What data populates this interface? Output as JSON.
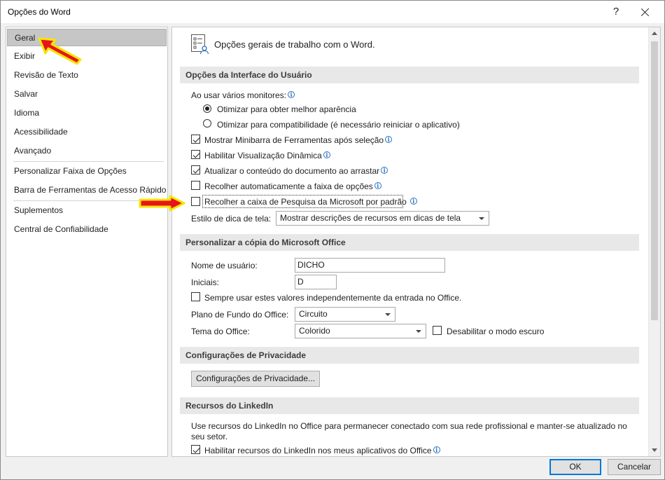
{
  "window": {
    "title": "Opções do Word",
    "help": "?",
    "close": "close"
  },
  "nav": {
    "items": [
      {
        "label": "Geral"
      },
      {
        "label": "Exibir"
      },
      {
        "label": "Revisão de Texto"
      },
      {
        "label": "Salvar"
      },
      {
        "label": "Idioma"
      },
      {
        "label": "Acessibilidade"
      },
      {
        "label": "Avançado"
      },
      {
        "label": "Personalizar Faixa de Opções"
      },
      {
        "label": "Barra de Ferramentas de Acesso Rápido"
      },
      {
        "label": "Suplementos"
      },
      {
        "label": "Central de Confiabilidade"
      }
    ],
    "selected": "Geral"
  },
  "content": {
    "header_title": "Opções gerais de trabalho com o Word.",
    "ui_section": {
      "title": "Opções da Interface do Usuário",
      "monitors_label": "Ao usar vários monitores:",
      "radio_appearance": "Otimizar para obter melhor aparência",
      "radio_compat": "Otimizar para compatibilidade (é necessário reiniciar o aplicativo)",
      "mini_toolbar": "Mostrar Minibarra de Ferramentas após seleção",
      "live_preview": "Habilitar Visualização Dinâmica",
      "update_drag": "Atualizar o conteúdo do documento ao arrastar",
      "collapse_ribbon": "Recolher automaticamente a faixa de opções",
      "collapse_search": "Recolher a caixa de Pesquisa da Microsoft por padrão",
      "tooltip_style_label": "Estilo de dica de tela:",
      "tooltip_style_value": "Mostrar descrições de recursos em dicas de tela"
    },
    "office_section": {
      "title": "Personalizar a cópia do Microsoft Office",
      "username_label": "Nome de usuário:",
      "username_value": "DICHO",
      "initials_label": "Iniciais:",
      "initials_value": "D",
      "always_use": "Sempre usar estes valores independentemente da entrada no Office.",
      "background_label": "Plano de Fundo do Office:",
      "background_value": "Circuito",
      "theme_label": "Tema do Office:",
      "theme_value": "Colorido",
      "disable_dark": "Desabilitar o modo escuro"
    },
    "privacy_section": {
      "title": "Configurações de Privacidade",
      "button": "Configurações de Privacidade..."
    },
    "linkedin_section": {
      "title": "Recursos do LinkedIn",
      "description": "Use recursos do LinkedIn no Office para permanecer conectado com sua rede profissional e manter-se atualizado no seu setor.",
      "enable": "Habilitar recursos do LinkedIn nos meus aplicativos do Office"
    }
  },
  "footer": {
    "ok": "OK",
    "cancel": "Cancelar"
  },
  "colors": {
    "annotation_arrow_fill": "#e8141c",
    "annotation_arrow_outline": "#f5e600",
    "info_icon": "#2b6fc0",
    "focus_border": "#0078d7"
  }
}
